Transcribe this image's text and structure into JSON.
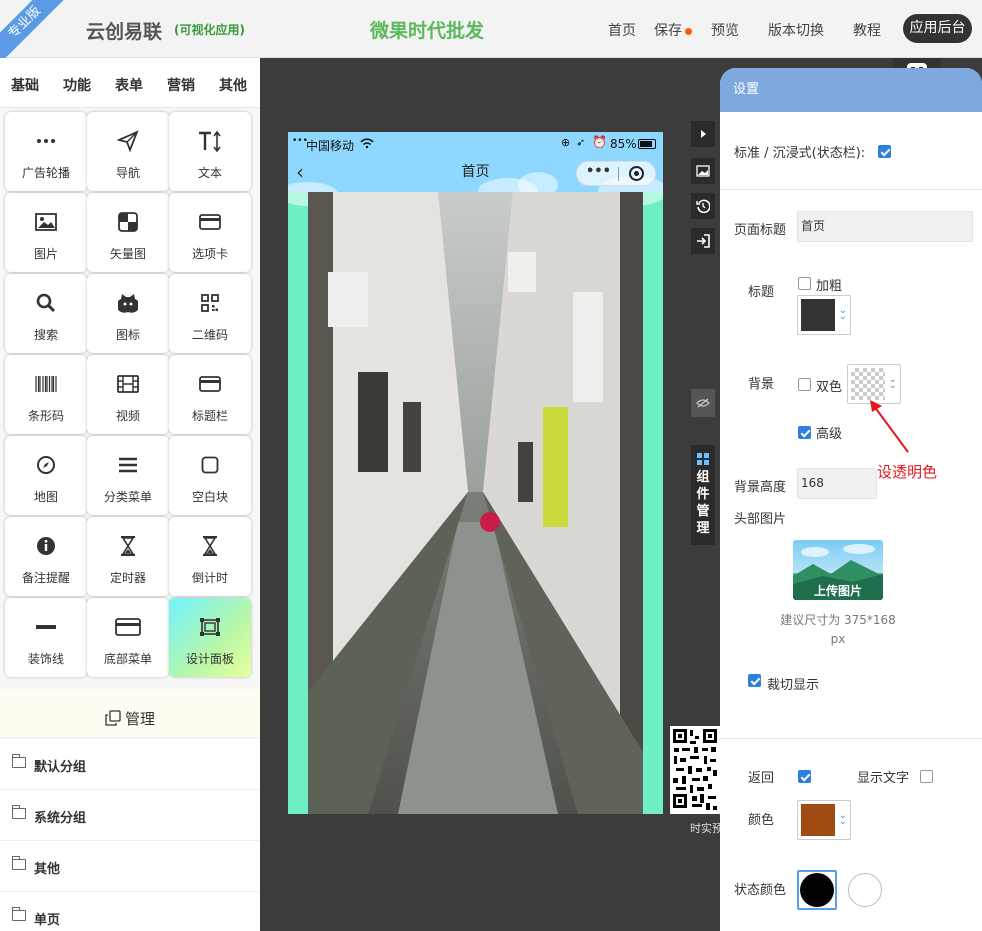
{
  "header": {
    "ribbon": "专业版",
    "brand": "云创易联",
    "brand_sub": "(可视化应用)",
    "shop_title": "微果时代批发",
    "nav": [
      "首页",
      "保存",
      "预览",
      "版本切换",
      "教程"
    ],
    "admin_btn": "应用后台",
    "save_dot_color": "#ff5c00"
  },
  "sidebar": {
    "tabs": [
      "基础",
      "功能",
      "表单",
      "营销",
      "其他"
    ],
    "components": [
      {
        "label": "广告轮播",
        "icon": "dots-icon"
      },
      {
        "label": "导航",
        "icon": "send-icon"
      },
      {
        "label": "文本",
        "icon": "text-icon"
      },
      {
        "label": "图片",
        "icon": "image-icon"
      },
      {
        "label": "矢量图",
        "icon": "vector-icon"
      },
      {
        "label": "选项卡",
        "icon": "card-icon"
      },
      {
        "label": "搜索",
        "icon": "search-icon"
      },
      {
        "label": "图标",
        "icon": "github-icon"
      },
      {
        "label": "二维码",
        "icon": "qrcode-icon"
      },
      {
        "label": "条形码",
        "icon": "barcode-icon"
      },
      {
        "label": "视频",
        "icon": "film-icon"
      },
      {
        "label": "标题栏",
        "icon": "card-icon"
      },
      {
        "label": "地图",
        "icon": "compass-icon"
      },
      {
        "label": "分类菜单",
        "icon": "menu-icon"
      },
      {
        "label": "空白块",
        "icon": "square-icon"
      },
      {
        "label": "备注提醒",
        "icon": "info-icon"
      },
      {
        "label": "定时器",
        "icon": "hourglass-icon"
      },
      {
        "label": "倒计时",
        "icon": "hourglass-icon"
      },
      {
        "label": "装饰线",
        "icon": "line-icon"
      },
      {
        "label": "底部菜单",
        "icon": "card-icon"
      },
      {
        "label": "设计面板",
        "icon": "frame-icon"
      }
    ],
    "manage_label": "管理",
    "groups": [
      "默认分组",
      "系统分组",
      "其他",
      "单页"
    ]
  },
  "phone": {
    "carrier": "中国移动",
    "battery": "85%",
    "page_title": "首页",
    "capsule_dots": "•••"
  },
  "preview_side": {
    "component_manage": [
      "组",
      "件",
      "管",
      "理"
    ],
    "realtime_label": "时实预"
  },
  "settings": {
    "header": "设置",
    "immersive_label": "标准 / 沉浸式(状态栏):",
    "page_title_label": "页面标题",
    "page_title_value": "首页",
    "title_label": "标题",
    "bold_label": "加粗",
    "title_color": "#333333",
    "bg_label": "背景",
    "dual_color_label": "双色",
    "advanced_label": "高级",
    "bg_height_label": "背景高度",
    "bg_height_value": "168",
    "header_img_label": "头部图片",
    "upload_label": "上传图片",
    "size_hint": "建议尺寸为 375*168 px",
    "crop_label": "裁切显示",
    "back_label": "返回",
    "show_text_label": "显示文字",
    "color_label": "颜色",
    "back_color": "#a04a14",
    "status_color_label": "状态颜色"
  },
  "annotation": "设透明色"
}
